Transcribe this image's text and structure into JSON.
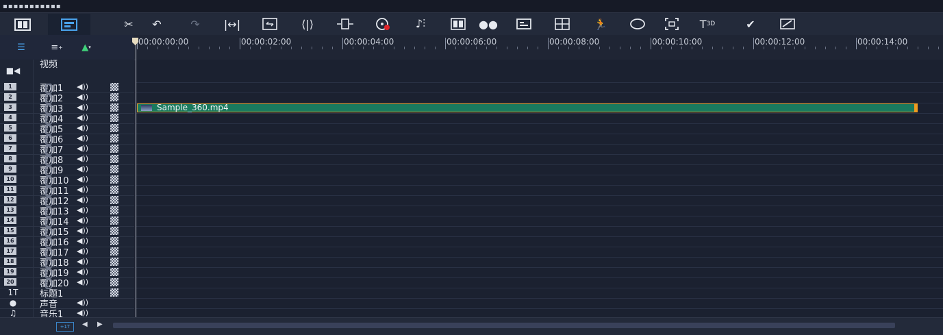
{
  "ruler": {
    "labels": [
      "00:00:00:00",
      "00:00:02:00",
      "00:00:04:00",
      "00:00:06:00",
      "00:00:08:00",
      "00:00:10:00",
      "00:00:12:00",
      "00:00:14:00"
    ]
  },
  "tracks": {
    "video": "视频",
    "overlays": [
      "覆加1",
      "覆加2",
      "覆加3",
      "覆加4",
      "覆加5",
      "覆加6",
      "覆加7",
      "覆加8",
      "覆加9",
      "覆加10",
      "覆加11",
      "覆加12",
      "覆加13",
      "覆加14",
      "覆加15",
      "覆加16",
      "覆加17",
      "覆加18",
      "覆加19",
      "覆加20"
    ],
    "numbers": [
      "1",
      "2",
      "3",
      "4",
      "5",
      "6",
      "7",
      "8",
      "9",
      "10",
      "11",
      "12",
      "13",
      "14",
      "15",
      "16",
      "17",
      "18",
      "19",
      "20"
    ],
    "title": "标题1",
    "voice": "声音",
    "music": "音乐1",
    "title_badge": "1T"
  },
  "clip": {
    "name": "Sample_360.mp4"
  },
  "bottom": {
    "zoom_badge": "+1T"
  },
  "colors": {
    "clip": "#1a7a5e",
    "clip_border": "#d99a2b",
    "accent": "#4aa3ec"
  }
}
